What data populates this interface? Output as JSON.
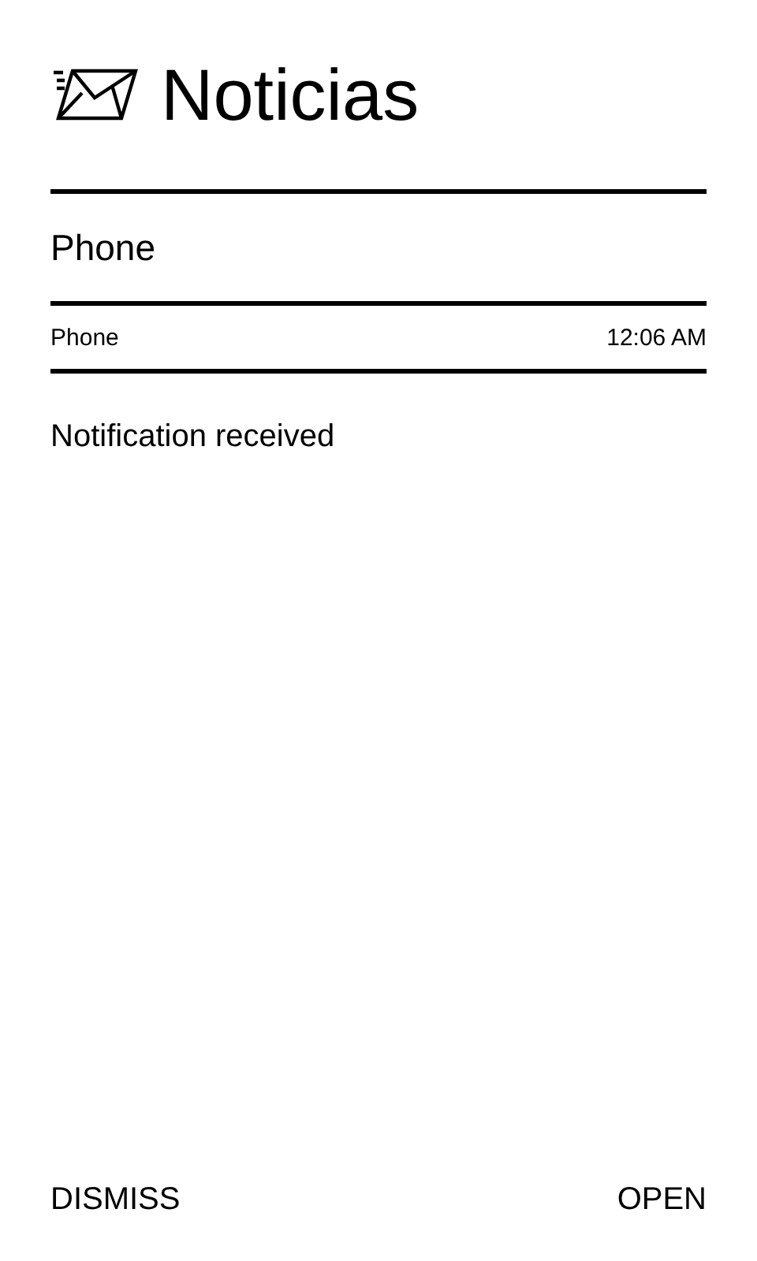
{
  "header": {
    "title": "Noticias"
  },
  "notification": {
    "title": "Phone",
    "app": "Phone",
    "time": "12:06 AM",
    "message": "Notification received"
  },
  "actions": [
    {
      "label": "DISMISS"
    },
    {
      "label": "OPEN"
    }
  ]
}
